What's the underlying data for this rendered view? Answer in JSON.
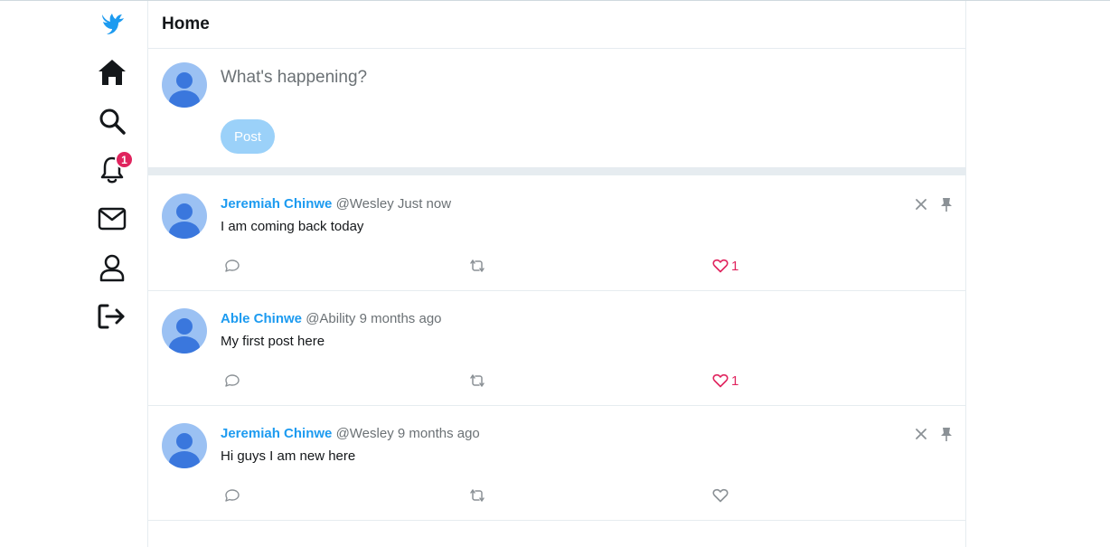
{
  "app": {
    "logo_icon": "bird-icon",
    "accent_color": "#1d9bf0",
    "like_color": "#e0245e"
  },
  "sidebar": {
    "items": [
      {
        "name": "home",
        "icon": "home-icon"
      },
      {
        "name": "search",
        "icon": "search-icon"
      },
      {
        "name": "notifications",
        "icon": "bell-icon",
        "badge": "1"
      },
      {
        "name": "messages",
        "icon": "mail-icon"
      },
      {
        "name": "profile",
        "icon": "user-icon"
      },
      {
        "name": "logout",
        "icon": "logout-icon"
      }
    ]
  },
  "header": {
    "title": "Home"
  },
  "composer": {
    "placeholder": "What's happening?",
    "post_label": "Post"
  },
  "tweets": [
    {
      "name": "Jeremiah Chinwe",
      "handle": "@Wesley",
      "time": "Just now",
      "text": "I am coming back today",
      "likes": "1",
      "liked": true,
      "owned": true
    },
    {
      "name": "Able Chinwe",
      "handle": "@Ability",
      "time": "9 months ago",
      "text": "My first post here",
      "likes": "1",
      "liked": true,
      "owned": false
    },
    {
      "name": "Jeremiah Chinwe",
      "handle": "@Wesley",
      "time": "9 months ago",
      "text": "Hi guys I am new here",
      "likes": "",
      "liked": false,
      "owned": true
    }
  ]
}
